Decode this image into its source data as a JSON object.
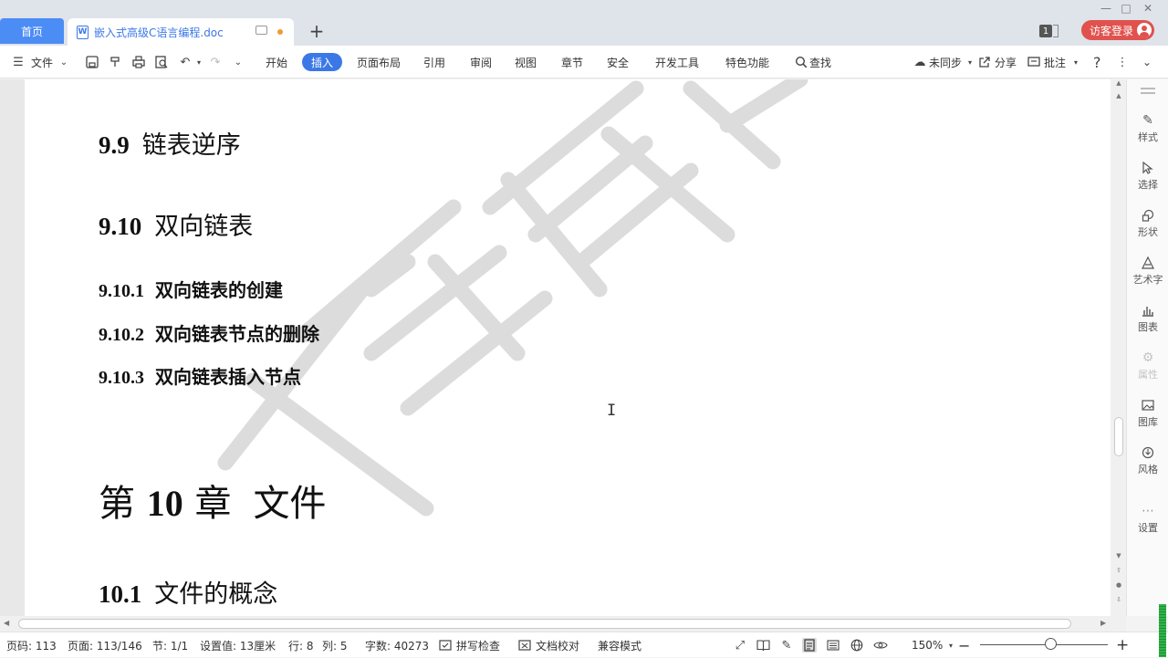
{
  "titlebar": {
    "home_tab": "首页",
    "doc_tab": {
      "icon_letter": "W",
      "title": "嵌入式高级C语言编程.doc"
    },
    "add_tab": "+",
    "badge": "1",
    "login_label": "访客登录"
  },
  "toolbar": {
    "file_menu": "文件",
    "tabs": [
      "开始",
      "插入",
      "页面布局",
      "引用",
      "审阅",
      "视图",
      "章节",
      "安全",
      "开发工具",
      "特色功能"
    ],
    "active_tab": "插入",
    "search_label": "查找",
    "sync_label": "未同步",
    "share_label": "分享",
    "comment_label": "批注",
    "help": "?"
  },
  "document": {
    "watermark_text": "千锋教育",
    "headings": [
      {
        "level": 2,
        "num": "9.9",
        "text": "链表逆序"
      },
      {
        "level": 2,
        "num": "9.10",
        "text": "双向链表"
      },
      {
        "level": 3,
        "num": "9.10.1",
        "text": "双向链表的创建"
      },
      {
        "level": 3,
        "num": "9.10.2",
        "text": "双向链表节点的删除"
      },
      {
        "level": 3,
        "num": "9.10.3",
        "text": "双向链表插入节点"
      },
      {
        "level": 1,
        "prefix": "第",
        "num": "10",
        "suffix": "章",
        "text": "文件"
      },
      {
        "level": 2,
        "num": "10.1",
        "text": "文件的概念"
      }
    ]
  },
  "sidebar": {
    "items": [
      {
        "label": "样式",
        "icon": "pen-icon",
        "enabled": true
      },
      {
        "label": "选择",
        "icon": "cursor-icon",
        "enabled": true
      },
      {
        "label": "形状",
        "icon": "shape-icon",
        "enabled": true
      },
      {
        "label": "艺术字",
        "icon": "wordart-icon",
        "enabled": true
      },
      {
        "label": "图表",
        "icon": "chart-icon",
        "enabled": true
      },
      {
        "label": "属性",
        "icon": "property-icon",
        "enabled": false
      },
      {
        "label": "图库",
        "icon": "gallery-icon",
        "enabled": true
      },
      {
        "label": "风格",
        "icon": "style-icon",
        "enabled": true
      },
      {
        "label": "设置",
        "icon": "more-icon",
        "enabled": true
      }
    ]
  },
  "statusbar": {
    "page_code": "页码: 113",
    "page": "页面: 113/146",
    "section": "节: 1/1",
    "setting": "设置值: 13厘米",
    "row": "行: 8",
    "col": "列: 5",
    "word_count": "字数: 40273",
    "spell_check": "拼写检查",
    "doc_proof": "文档校对",
    "compat_mode": "兼容模式",
    "zoom": "150%",
    "zoom_minus": "−",
    "zoom_plus": "+"
  },
  "colors": {
    "accent": "#3b78e7",
    "home_tab": "#4c8cf5",
    "login": "#e0524e",
    "unsaved_dot": "#f09a37"
  }
}
